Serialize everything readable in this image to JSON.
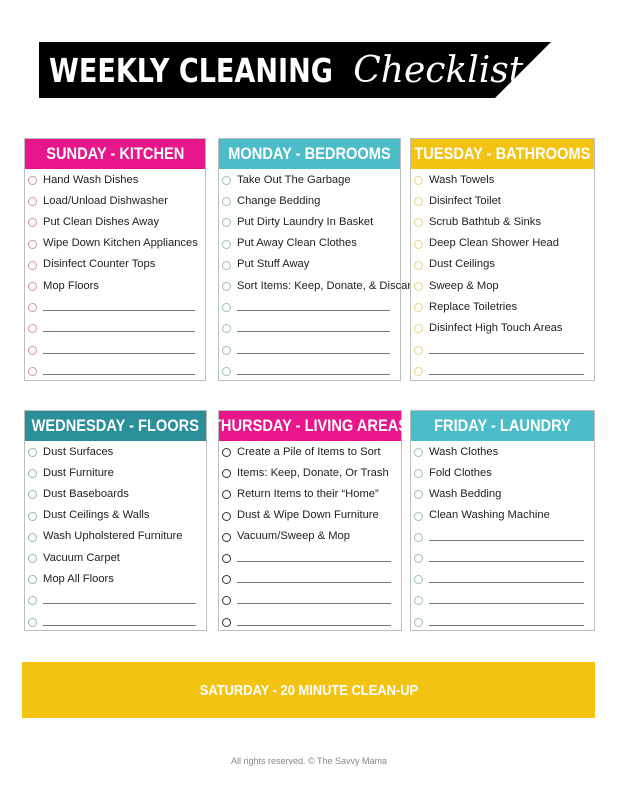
{
  "title": {
    "main": "WEEKLY CLEANING",
    "script": "Checklist"
  },
  "colors": {
    "pink": "#e8168a",
    "teal": "#4bbcc8",
    "yellow": "#f3c312",
    "darkteal": "#2a8f98",
    "black": "#000000"
  },
  "days": [
    {
      "header": "SUNDAY - KITCHEN",
      "color": "#e8168a",
      "circle": "#d98fb8",
      "items": [
        "Hand Wash Dishes",
        "Load/Unload Dishwasher",
        "Put Clean Dishes Away",
        "Wipe Down Kitchen Appliances",
        "Disinfect Counter Tops",
        "Mop Floors"
      ],
      "blank_lines": 4
    },
    {
      "header": "MONDAY - BEDROOMS",
      "color": "#4bbcc8",
      "circle": "#9cbfc4",
      "items": [
        "Take Out The Garbage",
        "Change Bedding",
        "Put Dirty Laundry In Basket",
        "Put Away Clean Clothes",
        "Put Stuff Away",
        "Sort Items: Keep, Donate, & Discard"
      ],
      "blank_lines": 4
    },
    {
      "header": "TUESDAY - BATHROOMS",
      "color": "#f3c312",
      "circle": "#e8d48a",
      "items": [
        "Wash Towels",
        "Disinfect Toilet",
        "Scrub Bathtub & Sinks",
        "Deep Clean Shower Head",
        "Dust Ceilings",
        "Sweep & Mop",
        "Replace Toiletries",
        "Disinfect High Touch Areas"
      ],
      "blank_lines": 2
    },
    {
      "header": "WEDNESDAY - FLOORS",
      "color": "#2a8f98",
      "circle": "#94b6b9",
      "items": [
        "Dust Surfaces",
        "Dust Furniture",
        "Dust Baseboards",
        "Dust Ceilings & Walls",
        "Wash Upholstered Furniture",
        "Vacuum Carpet",
        "Mop All Floors"
      ],
      "blank_lines": 2
    },
    {
      "header": "THURSDAY - LIVING AREAS",
      "color": "#e8168a",
      "circle": "#333333",
      "items": [
        "Create a Pile of Items to Sort",
        "Items: Keep, Donate, Or Trash",
        "Return Items to their “Home”",
        "Dust & Wipe Down Furniture",
        "Vacuum/Sweep & Mop"
      ],
      "blank_lines": 4
    },
    {
      "header": "FRIDAY - LAUNDRY",
      "color": "#4bbcc8",
      "circle": "#9cbfc4",
      "items": [
        "Wash Clothes",
        "Fold Clothes",
        "Wash Bedding",
        "Clean Washing Machine"
      ],
      "blank_lines": 5
    }
  ],
  "saturday": {
    "label": "SATURDAY - 20 MINUTE CLEAN-UP",
    "color": "#f3c312"
  },
  "footer": "All rights reserved. © The Savvy Mama"
}
